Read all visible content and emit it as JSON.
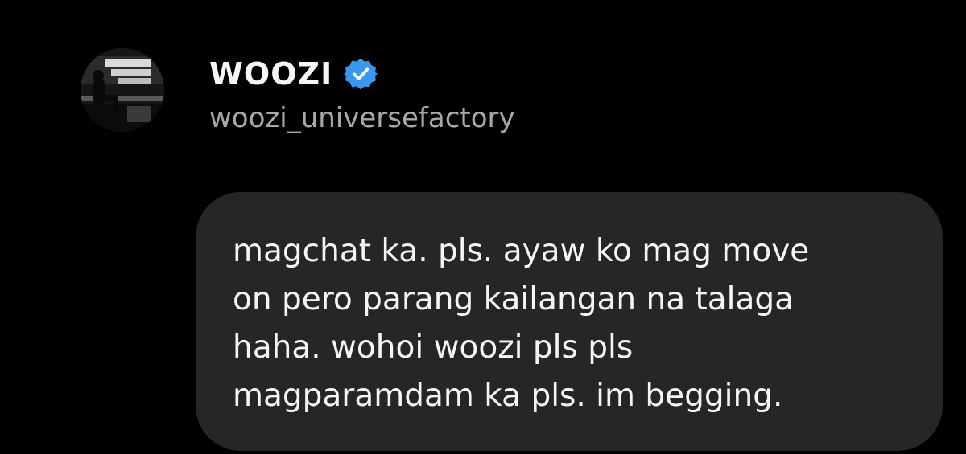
{
  "profile": {
    "display_name": "WOOZI",
    "username": "woozi_universefactory",
    "verified": true,
    "avatar_icon": "profile-photo-icon",
    "verified_icon": "verified-badge-icon",
    "verified_color": "#3897f0"
  },
  "message": {
    "text": "magchat ka. pls. ayaw ko mag move\non pero parang kailangan na talaga\nhaha. wohoi woozi pls pls\nmagparamdam ka pls. im begging.",
    "bubble_color": "#262626"
  }
}
